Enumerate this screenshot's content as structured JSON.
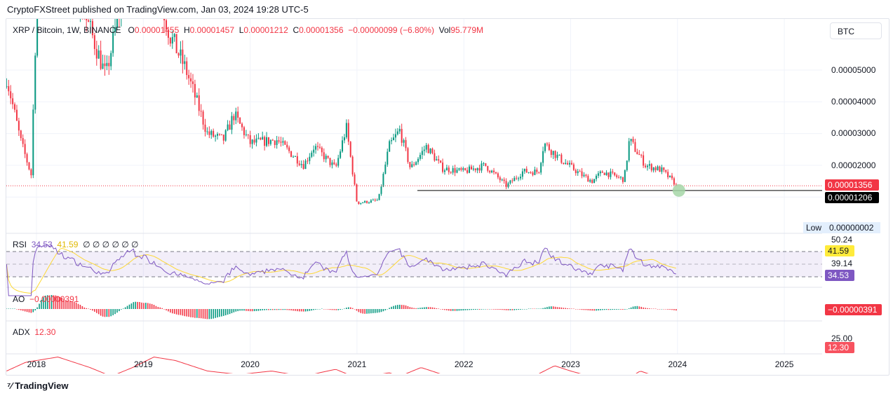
{
  "published": "CryptoFXStreet published on TradingView.com, Jan 03, 2024 19:28 UTC-5",
  "legend": {
    "symbol": "XRP / Bitcoin, 1W, BINANCE",
    "o_label": "O",
    "o": "0.00001455",
    "h_label": "H",
    "h": "0.00001457",
    "l_label": "L",
    "l": "0.00001212",
    "c_label": "C",
    "c": "0.00001356",
    "change": "−0.00000099 (−6.80%)",
    "vol_label": "Vol",
    "vol": "95.779M"
  },
  "currency_button": "BTC",
  "price_axis": [
    "0.00005000",
    "0.00004000",
    "0.00003000",
    "0.00002000"
  ],
  "current_price_tag": "0.00001356",
  "support_tag": "0.00001206",
  "low": {
    "label": "Low",
    "value": "0.00000002"
  },
  "rsi": {
    "label": "RSI",
    "value": "34.53",
    "ma": "41.59",
    "extra": "∅ ∅ ∅ ∅ ∅ ∅",
    "axis": [
      "50.24",
      "39.14"
    ],
    "tag_ma": "41.59",
    "tag_value": "34.53"
  },
  "ao": {
    "label": "AO",
    "value": "−0.00000391",
    "tag": "−0.00000391"
  },
  "adx": {
    "label": "ADX",
    "value": "12.30",
    "axis": "25.00",
    "tag": "12.30"
  },
  "time_axis": [
    "2018",
    "2019",
    "2020",
    "2021",
    "2022",
    "2023",
    "2024",
    "2025"
  ],
  "brand": "TradingView",
  "colors": {
    "up": "#089981",
    "down": "#f23645",
    "rsi": "#7e57c2",
    "rsi_ma": "#fdd835",
    "adx": "#f23645",
    "support": "#000000",
    "marker": "#a5d6a7"
  },
  "chart_data": {
    "type": "candlestick",
    "title": "XRP / Bitcoin, 1W, BINANCE",
    "ylabel": "BTC",
    "ylim": [
      2e-07,
      5.22e-05
    ],
    "xlim": [
      2017.72,
      2025.5
    ],
    "support_level": 1.206e-05,
    "current_price": 1.356e-05,
    "close_path": [
      [
        2017.72,
        4.78e-05
      ],
      [
        2017.85,
        2.8e-05
      ],
      [
        2017.95,
        1.7e-05
      ],
      [
        2018.0,
        7e-05
      ],
      [
        2018.1,
        9e-05
      ],
      [
        2018.3,
        8e-05
      ],
      [
        2018.5,
        6.3e-05
      ],
      [
        2018.65,
        4.8e-05
      ],
      [
        2018.75,
        6.5e-05
      ],
      [
        2018.9,
        9e-05
      ],
      [
        2019.1,
        8e-05
      ],
      [
        2019.25,
        6.1e-05
      ],
      [
        2019.4,
        5e-05
      ],
      [
        2019.6,
        3e-05
      ],
      [
        2019.75,
        2.8e-05
      ],
      [
        2019.85,
        3.6e-05
      ],
      [
        2020.0,
        2.7e-05
      ],
      [
        2020.25,
        2.8e-05
      ],
      [
        2020.5,
        2e-05
      ],
      [
        2020.6,
        2.6e-05
      ],
      [
        2020.8,
        1.9e-05
      ],
      [
        2020.9,
        3.2e-05
      ],
      [
        2021.0,
        8.1e-06
      ],
      [
        2021.2,
        9e-06
      ],
      [
        2021.3,
        2.6e-05
      ],
      [
        2021.4,
        3.1e-05
      ],
      [
        2021.5,
        1.9e-05
      ],
      [
        2021.65,
        2.6e-05
      ],
      [
        2021.8,
        1.9e-05
      ],
      [
        2022.0,
        1.8e-05
      ],
      [
        2022.2,
        2e-05
      ],
      [
        2022.4,
        1.35e-05
      ],
      [
        2022.55,
        1.8e-05
      ],
      [
        2022.7,
        1.8e-05
      ],
      [
        2022.75,
        2.7e-05
      ],
      [
        2022.9,
        2.2e-05
      ],
      [
        2023.1,
        1.7e-05
      ],
      [
        2023.2,
        1.5e-05
      ],
      [
        2023.3,
        1.8e-05
      ],
      [
        2023.5,
        1.55e-05
      ],
      [
        2023.55,
        2.8e-05
      ],
      [
        2023.7,
        2e-05
      ],
      [
        2023.85,
        1.85e-05
      ],
      [
        2024.0,
        1.356e-05
      ]
    ],
    "adx_path": [
      [
        2017.72,
        18
      ],
      [
        2017.9,
        23
      ],
      [
        2018.2,
        26
      ],
      [
        2018.5,
        20
      ],
      [
        2018.7,
        15
      ],
      [
        2018.9,
        20
      ],
      [
        2019.1,
        26
      ],
      [
        2019.3,
        24
      ],
      [
        2019.6,
        18
      ],
      [
        2019.9,
        16
      ],
      [
        2020.2,
        18
      ],
      [
        2020.5,
        15
      ],
      [
        2020.8,
        19
      ],
      [
        2021.0,
        14
      ],
      [
        2021.3,
        17
      ],
      [
        2021.4,
        15
      ],
      [
        2021.6,
        20
      ],
      [
        2021.8,
        16
      ],
      [
        2022.0,
        13
      ],
      [
        2022.3,
        12
      ],
      [
        2022.6,
        13
      ],
      [
        2022.72,
        17
      ],
      [
        2022.85,
        21
      ],
      [
        2023.0,
        18
      ],
      [
        2023.3,
        13
      ],
      [
        2023.5,
        12
      ],
      [
        2023.65,
        18
      ],
      [
        2023.8,
        15
      ],
      [
        2024.0,
        12.3
      ]
    ]
  }
}
